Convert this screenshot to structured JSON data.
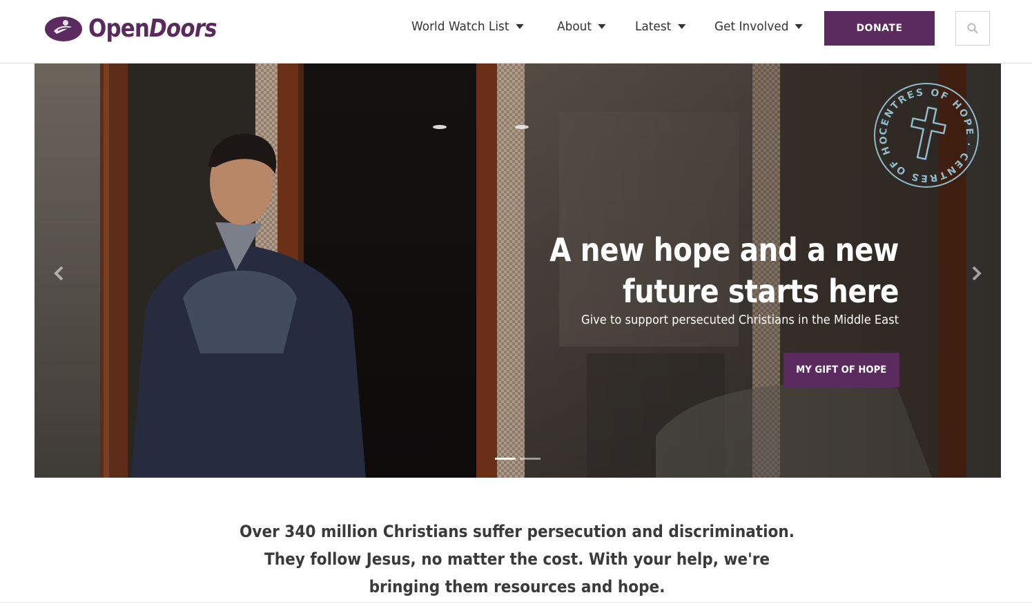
{
  "brand": {
    "name_part1": "Open",
    "name_part2": "Doors",
    "primary_color": "#5b2a5f"
  },
  "nav": {
    "items": [
      {
        "label": "World Watch List"
      },
      {
        "label": "About"
      },
      {
        "label": "Latest"
      },
      {
        "label": "Get Involved"
      }
    ],
    "donate_label": "DONATE",
    "search_icon": "search-icon"
  },
  "hero": {
    "title_line1": "A new hope and a new",
    "title_line2": "future starts here",
    "subtitle": "Give to support persecuted Christians in the Middle East",
    "cta_label": "MY GIFT OF HOPE",
    "badge_text": "CENTRES OF HOPE · CENTRES OF HOPE ·",
    "badge_color": "#8fbccd",
    "slides_total": 2,
    "active_slide": 1
  },
  "intro": {
    "text": "Over 340 million Christians suffer persecution and discrimination. They follow Jesus, no matter the cost. With your help, we're bringing them resources and hope."
  }
}
